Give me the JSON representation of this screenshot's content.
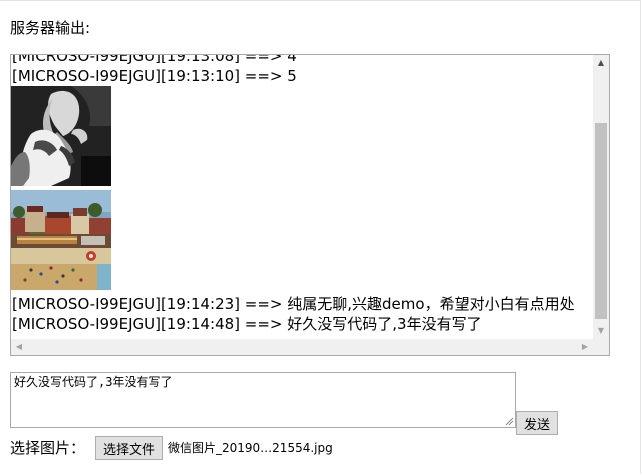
{
  "output": {
    "heading": "服务器输出:",
    "lines_before": [
      "[MICROSO-I99EJGU][19:13:08] ==> 4",
      "[MICROSO-I99EJGU][19:13:10] ==> 5"
    ],
    "lines_after": [
      "[MICROSO-I99EJGU][19:14:23] ==> 纯属无聊,兴趣demo，希望对小白有点用处",
      "[MICROSO-I99EJGU][19:14:48] ==> 好久没写代码了,3年没有写了"
    ]
  },
  "composer": {
    "message_value": "好久没写代码了,3年没有写了",
    "send_label": "发送"
  },
  "file": {
    "label": "选择图片：",
    "button_label": "选择文件",
    "selected_name": "微信图片_20190…21554.jpg"
  }
}
